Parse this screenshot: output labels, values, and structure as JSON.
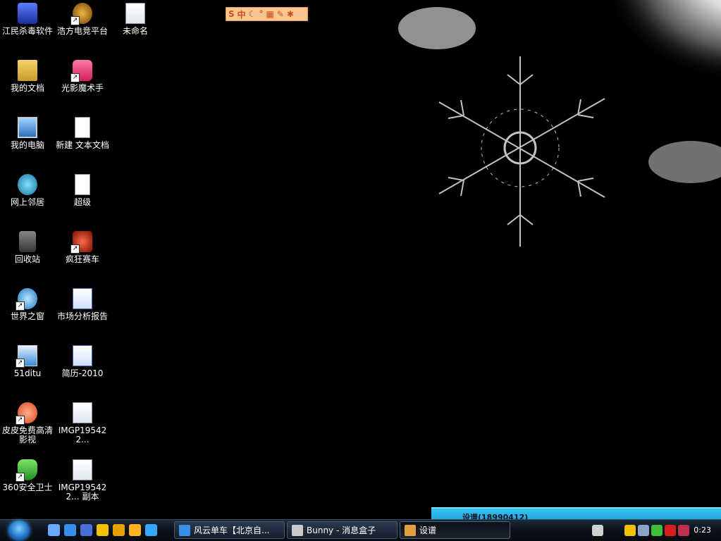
{
  "desktop": {
    "icons": [
      {
        "label": "江民杀毒软件",
        "icon": "jiangmin-antivirus-icon",
        "shortcut": false
      },
      {
        "label": "浩方电竞平台",
        "icon": "haofang-gaming-icon",
        "shortcut": true
      },
      {
        "label": "未命名",
        "icon": "image-file-icon",
        "shortcut": false
      },
      {
        "label": "我的文档",
        "icon": "my-documents-icon",
        "shortcut": false
      },
      {
        "label": "光影魔术手",
        "icon": "photo-editor-icon",
        "shortcut": true
      },
      {
        "label": "我的电脑",
        "icon": "my-computer-icon",
        "shortcut": false
      },
      {
        "label": "新建 文本文档",
        "icon": "text-document-icon",
        "shortcut": false
      },
      {
        "label": "网上邻居",
        "icon": "network-places-icon",
        "shortcut": false
      },
      {
        "label": "超级",
        "icon": "text-document-icon",
        "shortcut": false
      },
      {
        "label": "回收站",
        "icon": "recycle-bin-icon",
        "shortcut": false
      },
      {
        "label": "疯狂赛车",
        "icon": "racing-game-icon",
        "shortcut": true
      },
      {
        "label": "世界之窗",
        "icon": "theworld-browser-icon",
        "shortcut": true
      },
      {
        "label": "市场分析报告",
        "icon": "word-document-icon",
        "shortcut": false
      },
      {
        "label": "51ditu",
        "icon": "map-app-icon",
        "shortcut": true
      },
      {
        "label": "简历-2010",
        "icon": "word-document-icon",
        "shortcut": false
      },
      {
        "label": "皮皮免费高清影视",
        "icon": "video-player-icon",
        "shortcut": true
      },
      {
        "label": "IMGP195422...",
        "icon": "image-file-icon",
        "shortcut": false
      },
      {
        "label": "360安全卫士",
        "icon": "360-security-icon",
        "shortcut": true
      },
      {
        "label": "IMGP195422... 副本",
        "icon": "image-file-icon",
        "shortcut": false
      }
    ]
  },
  "ime_bar": {
    "logo": "S",
    "mode": "中"
  },
  "qq_popup": {
    "text": "设谱(18990412)"
  },
  "taskbar": {
    "quick_launch": [
      "show-desktop-icon",
      "ie-browser-icon",
      "media-player-icon",
      "qq-icon",
      "qq-group-icon",
      "smiley-icon",
      "messenger-icon"
    ],
    "tasks": [
      {
        "label": "风云单车【北京自...",
        "icon": "ie-browser-icon",
        "active": false
      },
      {
        "label": "Bunny - 消息盒子",
        "icon": "message-box-icon",
        "active": false
      },
      {
        "label": "设谱",
        "icon": "qq-contacts-icon",
        "active": true
      }
    ],
    "tray_icons": [
      "keyboard-icon",
      "qq-icon",
      "network-icon",
      "360-security-icon",
      "kaspersky-icon",
      "shield-icon"
    ],
    "clock": "0:23"
  }
}
